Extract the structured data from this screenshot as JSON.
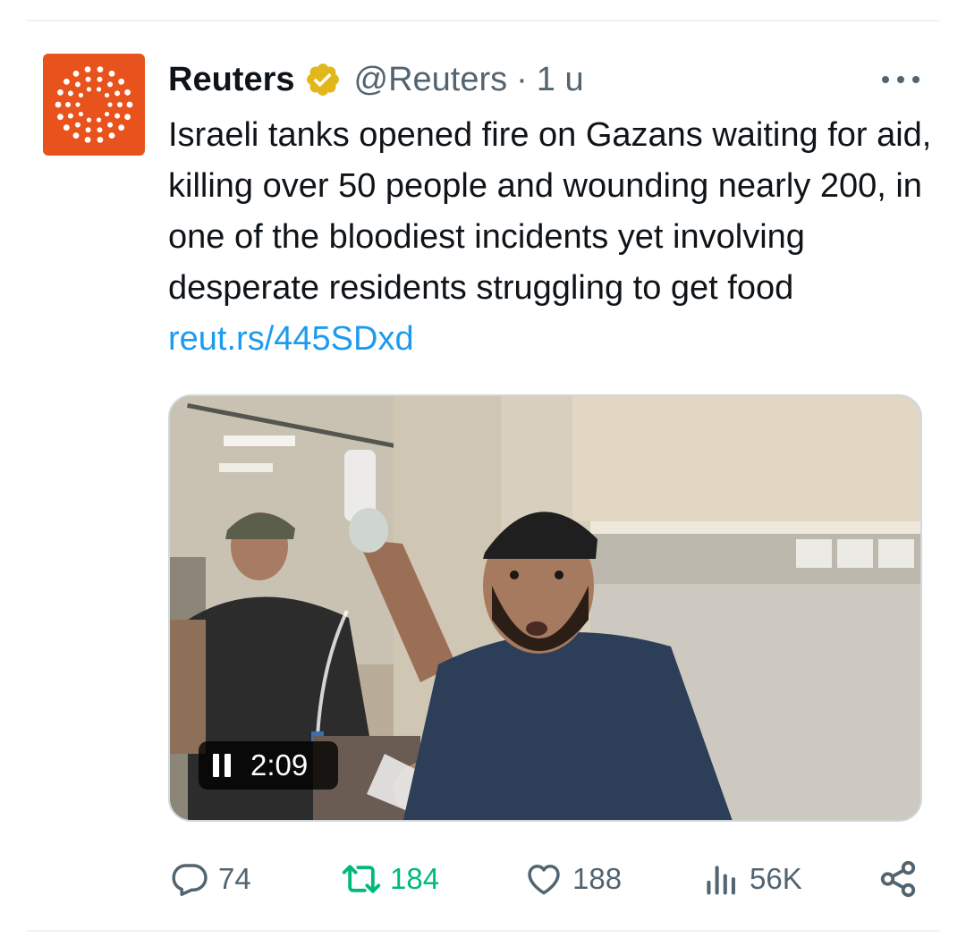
{
  "tweet": {
    "author_name": "Reuters",
    "handle": "@Reuters",
    "separator": "·",
    "time": "1 u",
    "text": "Israeli tanks opened fire on Gazans waiting for aid, killing over 50 people and wounding nearly 200, in one of the bloodiest incidents yet involving desperate residents struggling to get food ",
    "link": "reut.rs/445SDxd"
  },
  "video": {
    "duration": "2:09",
    "state": "playing"
  },
  "actions": {
    "replies": "74",
    "retweets": "184",
    "likes": "188",
    "views": "56K"
  },
  "colors": {
    "brand": "#e8521c",
    "link": "#1d9bf0",
    "retweet_active": "#00ba7c",
    "muted": "#536471",
    "verified": "#e2b719"
  },
  "icons": {
    "avatar": "reuters-logo-icon",
    "verified": "verified-badge-icon",
    "more": "more-options-icon",
    "pause": "pause-icon",
    "reply": "reply-icon",
    "retweet": "retweet-icon",
    "like": "heart-icon",
    "views": "views-icon",
    "share": "share-icon"
  }
}
